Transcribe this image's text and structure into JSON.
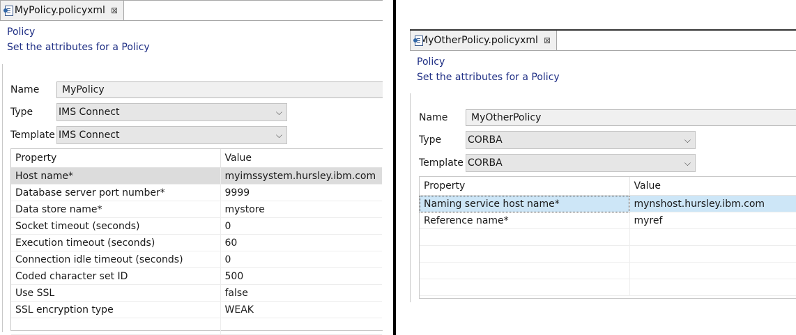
{
  "left": {
    "tab": {
      "label": "MyPolicy.policyxml",
      "close": "⊠"
    },
    "title": "Policy",
    "subtitle": "Set the attributes for a Policy",
    "name_label": "Name",
    "name_value": "MyPolicy",
    "type_label": "Type",
    "type_value": "IMS Connect",
    "template_label": "Template",
    "template_value": "IMS Connect",
    "table": {
      "headers": [
        "Property",
        "Value"
      ],
      "rows": [
        [
          "Host name*",
          "myimssystem.hursley.ibm.com"
        ],
        [
          "Database server port number*",
          "9999"
        ],
        [
          "Data store name*",
          "mystore"
        ],
        [
          "Socket timeout (seconds)",
          "0"
        ],
        [
          "Execution timeout (seconds)",
          "60"
        ],
        [
          "Connection idle timeout (seconds)",
          "0"
        ],
        [
          "Coded character set ID",
          "500"
        ],
        [
          "Use SSL",
          "false"
        ],
        [
          "SSL encryption type",
          "WEAK"
        ]
      ]
    }
  },
  "right": {
    "tab": {
      "label": "MyOtherPolicy.policyxml",
      "close": "⊠"
    },
    "title": "Policy",
    "subtitle": "Set the attributes for a Policy",
    "name_label": "Name",
    "name_value": "MyOtherPolicy",
    "type_label": "Type",
    "type_value": "CORBA",
    "template_label": "Template",
    "template_value": "CORBA",
    "table": {
      "headers": [
        "Property",
        "Value"
      ],
      "rows": [
        [
          "Naming service host name*",
          "mynshost.hursley.ibm.com"
        ],
        [
          "Reference name*",
          "myref"
        ]
      ]
    }
  },
  "icons": {
    "chevron": "⌵"
  }
}
